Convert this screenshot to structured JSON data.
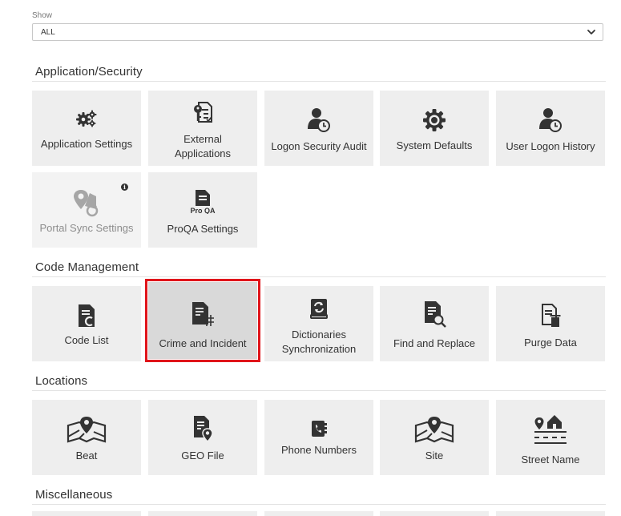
{
  "filter": {
    "label": "Show",
    "value": "ALL"
  },
  "sections": {
    "application_security": "Application/Security",
    "code_management": "Code Management",
    "locations": "Locations",
    "miscellaneous": "Miscellaneous"
  },
  "tiles": {
    "application_settings": {
      "label": "Application Settings",
      "icon": "gears-icon"
    },
    "external_applications": {
      "label_line1": "External",
      "label_line2": "Applications",
      "icon": "key-document-icon"
    },
    "logon_security_audit": {
      "label": "Logon Security Audit",
      "icon": "user-clock-icon"
    },
    "system_defaults": {
      "label": "System Defaults",
      "icon": "gear-icon"
    },
    "user_logon_history": {
      "label": "User Logon History",
      "icon": "user-clock-icon"
    },
    "portal_sync_settings": {
      "label": "Portal Sync Settings",
      "icon": "map-sync-icon",
      "info": "i"
    },
    "proqa_settings": {
      "label": "ProQA Settings",
      "icon_text": "Pro QA",
      "icon": "proqa-document-icon"
    },
    "code_list": {
      "label": "Code List",
      "icon": "code-document-icon"
    },
    "crime_and_incident": {
      "label": "Crime and Incident",
      "icon": "document-hash-icon"
    },
    "dictionaries_synchronization": {
      "label_line1": "Dictionaries",
      "label_line2": "Synchronization",
      "icon": "book-sync-icon"
    },
    "find_and_replace": {
      "label": "Find and Replace",
      "icon": "document-search-icon"
    },
    "purge_data": {
      "label": "Purge Data",
      "icon": "document-trash-icon"
    },
    "beat": {
      "label": "Beat",
      "icon": "map-pin-icon"
    },
    "geo_file": {
      "label": "GEO File",
      "icon": "document-pin-icon"
    },
    "phone_numbers": {
      "label": "Phone Numbers",
      "icon": "phone-book-icon"
    },
    "site": {
      "label": "Site",
      "icon": "map-pin-icon"
    },
    "street_name": {
      "label": "Street Name",
      "icon": "street-house-icon"
    }
  },
  "colors": {
    "tile_bg": "#eeeeee",
    "selected_outline": "#e0141a",
    "icon": "#333333"
  }
}
